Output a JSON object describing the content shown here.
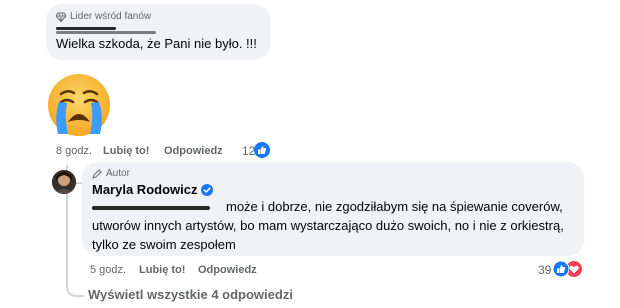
{
  "comment1": {
    "badge_label": "Lider wśród fanów",
    "text": "Wielka szkoda, że Pani nie było. !!!",
    "time": "8 godz.",
    "like_label": "Lubię to!",
    "reply_label": "Odpowiedz",
    "reactions_count": "12"
  },
  "reply": {
    "badge_label": "Autor",
    "author_name": "Maryla Rodowicz",
    "text_line1": "może i dobrze, nie zgodziłabym się na śpiewanie coverów,",
    "text_line2": "utworów innych artystów, bo mam wystarczająco dużo swoich, no i nie z orkiestrą,",
    "text_line3": "tylko ze swoim zespołem",
    "time": "5 godz.",
    "like_label": "Lubię to!",
    "reply_label": "Odpowiedz",
    "reactions_count": "39"
  },
  "view_all_replies": "Wyświetl wszystkie 4 odpowiedzi",
  "colors": {
    "bubble": "#f0f2f5",
    "secondary_text": "#65676b",
    "like_blue": "#1877f2",
    "love_red": "#f33e58",
    "verified_blue": "#1877f2"
  }
}
